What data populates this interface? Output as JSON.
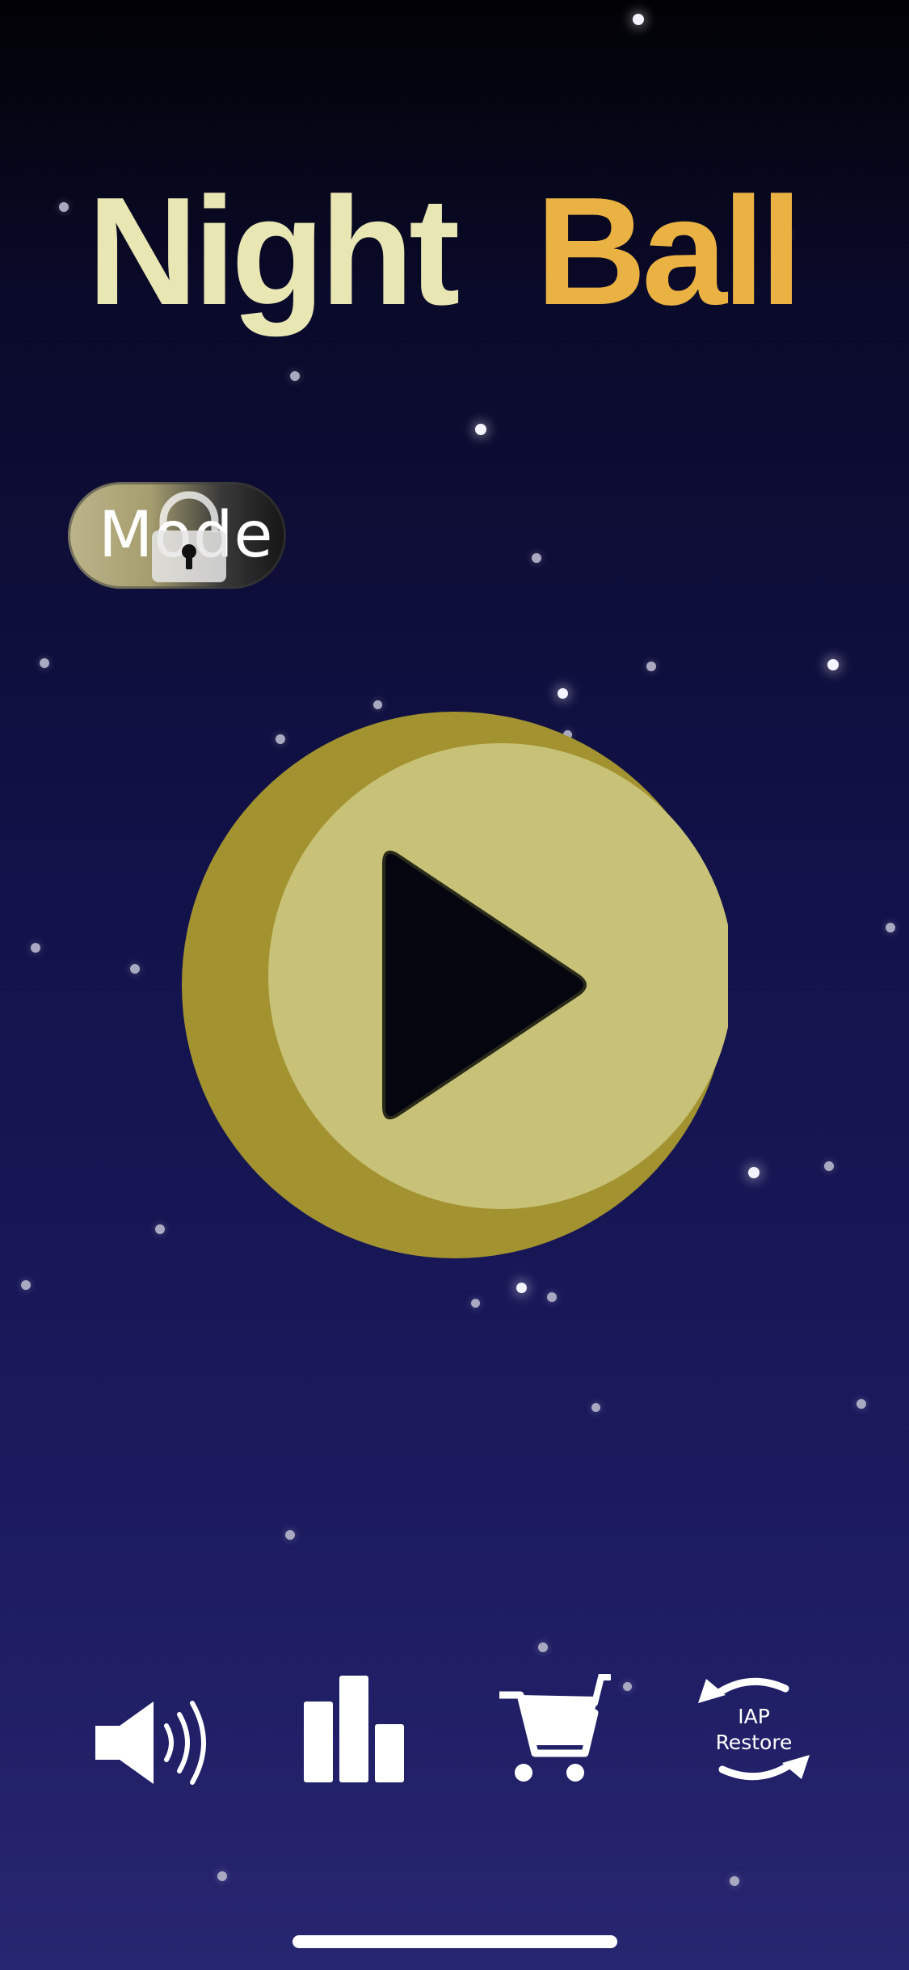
{
  "title": {
    "night": "Night",
    "ball": "Ball",
    "night_color": "#e8e6b3",
    "ball_color": "#eab143"
  },
  "mode_toggle": {
    "label": "Mode",
    "locked": true,
    "icon": "lock-icon"
  },
  "play_button": {
    "icon": "play-icon",
    "face_color": "#c8c178",
    "rim_color": "#a39330"
  },
  "bottom_bar": {
    "items": [
      {
        "id": "sound",
        "icon": "speaker-icon"
      },
      {
        "id": "leaderboard",
        "icon": "bar-chart-icon"
      },
      {
        "id": "shop",
        "icon": "cart-icon"
      },
      {
        "id": "iap_restore",
        "icon": "restore-arrows-icon",
        "line1": "IAP",
        "line2": "Restore"
      }
    ]
  }
}
